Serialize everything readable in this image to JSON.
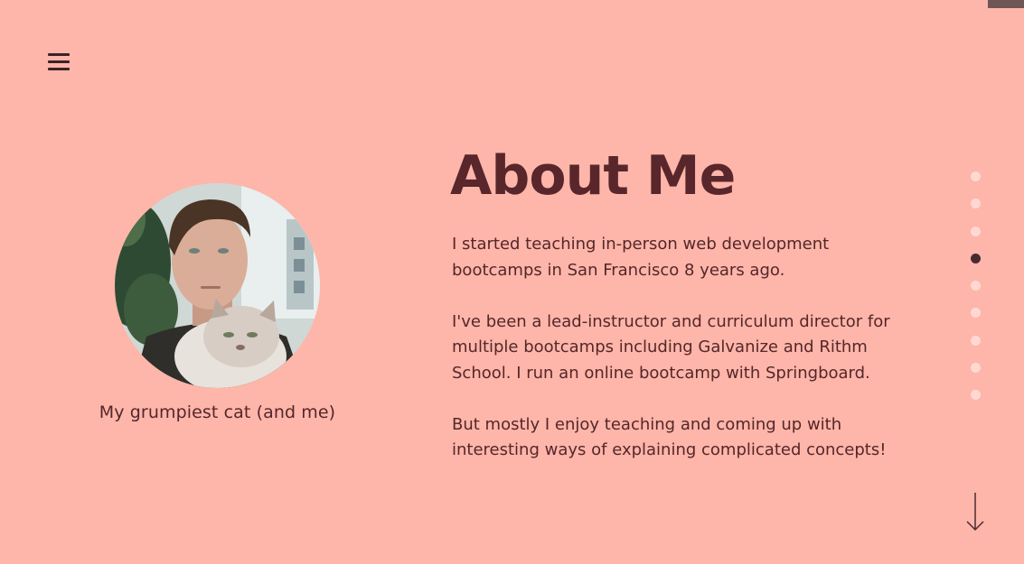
{
  "nav": {
    "menu_icon": "hamburger-menu-icon"
  },
  "profile": {
    "photo_alt": "",
    "caption": "My grumpiest cat (and me)"
  },
  "section": {
    "title": "About Me",
    "paragraphs": [
      "I started teaching in-person web development bootcamps in San Francisco 8 years ago.",
      "I've been a lead-instructor and curriculum director for multiple bootcamps including Galvanize and Rithm School.  I run an online bootcamp with Springboard.",
      "But mostly I enjoy teaching and coming up with interesting ways of explaining complicated concepts!"
    ]
  },
  "pagination": {
    "total": 9,
    "active_index": 3
  },
  "scroll": {
    "icon": "arrow-down-icon"
  },
  "colors": {
    "background": "#fdb6a9",
    "text": "#55262a",
    "heading": "#58262b",
    "dot_inactive": "#ffd9d1",
    "dot_active": "#4a2a32"
  }
}
